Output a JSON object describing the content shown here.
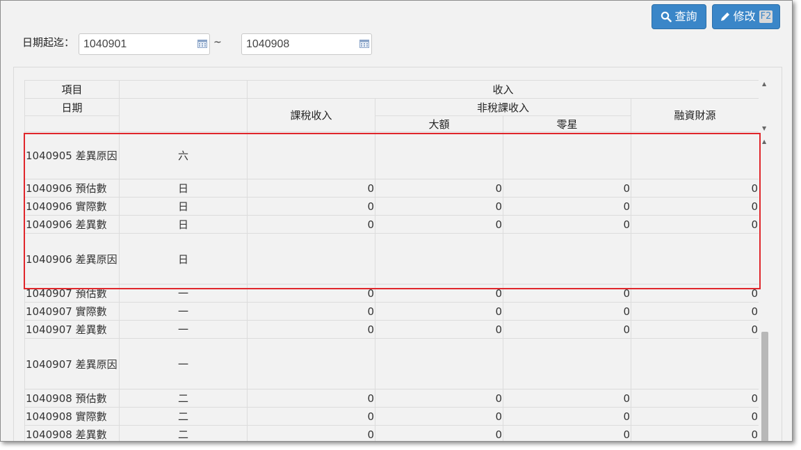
{
  "toolbar": {
    "search_label": "查詢",
    "edit_label": "修改",
    "edit_key": "F2"
  },
  "filter": {
    "date_label": "日期起迄：",
    "start_value": "1040901",
    "end_value": "1040908",
    "separator": "~"
  },
  "table": {
    "header": {
      "item_label": "項目",
      "date_label": "日期",
      "income_label": "收入",
      "taxed_label": "課稅收入",
      "nontax_label": "非稅課收入",
      "large_label": "大額",
      "small_label": "零星",
      "finance_label": "融資財源"
    },
    "rows": [
      {
        "item": "1040905 差異原因",
        "wd": "六",
        "v1": "",
        "v2": "",
        "v3": "",
        "v4": "",
        "tall": true
      },
      {
        "item": "1040906 預估數",
        "wd": "日",
        "v1": "0",
        "v2": "0",
        "v3": "0",
        "v4": "0",
        "tall": false
      },
      {
        "item": "1040906 實際數",
        "wd": "日",
        "v1": "0",
        "v2": "0",
        "v3": "0",
        "v4": "0",
        "tall": false
      },
      {
        "item": "1040906 差異數",
        "wd": "日",
        "v1": "0",
        "v2": "0",
        "v3": "0",
        "v4": "0",
        "tall": false
      },
      {
        "item": "1040906 差異原因",
        "wd": "日",
        "v1": "",
        "v2": "",
        "v3": "",
        "v4": "",
        "tall": true
      },
      {
        "item": "1040907 預估數",
        "wd": "一",
        "v1": "0",
        "v2": "0",
        "v3": "0",
        "v4": "0",
        "tall": false
      },
      {
        "item": "1040907 實際數",
        "wd": "一",
        "v1": "0",
        "v2": "0",
        "v3": "0",
        "v4": "0",
        "tall": false
      },
      {
        "item": "1040907 差異數",
        "wd": "一",
        "v1": "0",
        "v2": "0",
        "v3": "0",
        "v4": "0",
        "tall": false
      },
      {
        "item": "1040907 差異原因",
        "wd": "一",
        "v1": "",
        "v2": "",
        "v3": "",
        "v4": "",
        "tall": true
      },
      {
        "item": "1040908 預估數",
        "wd": "二",
        "v1": "0",
        "v2": "0",
        "v3": "0",
        "v4": "0",
        "tall": false
      },
      {
        "item": "1040908 實際數",
        "wd": "二",
        "v1": "0",
        "v2": "0",
        "v3": "0",
        "v4": "0",
        "tall": false
      },
      {
        "item": "1040908 差異數",
        "wd": "二",
        "v1": "0",
        "v2": "0",
        "v3": "0",
        "v4": "0",
        "tall": false
      }
    ]
  },
  "colors": {
    "accent": "#3a86c8",
    "selection": "#e0262b"
  }
}
